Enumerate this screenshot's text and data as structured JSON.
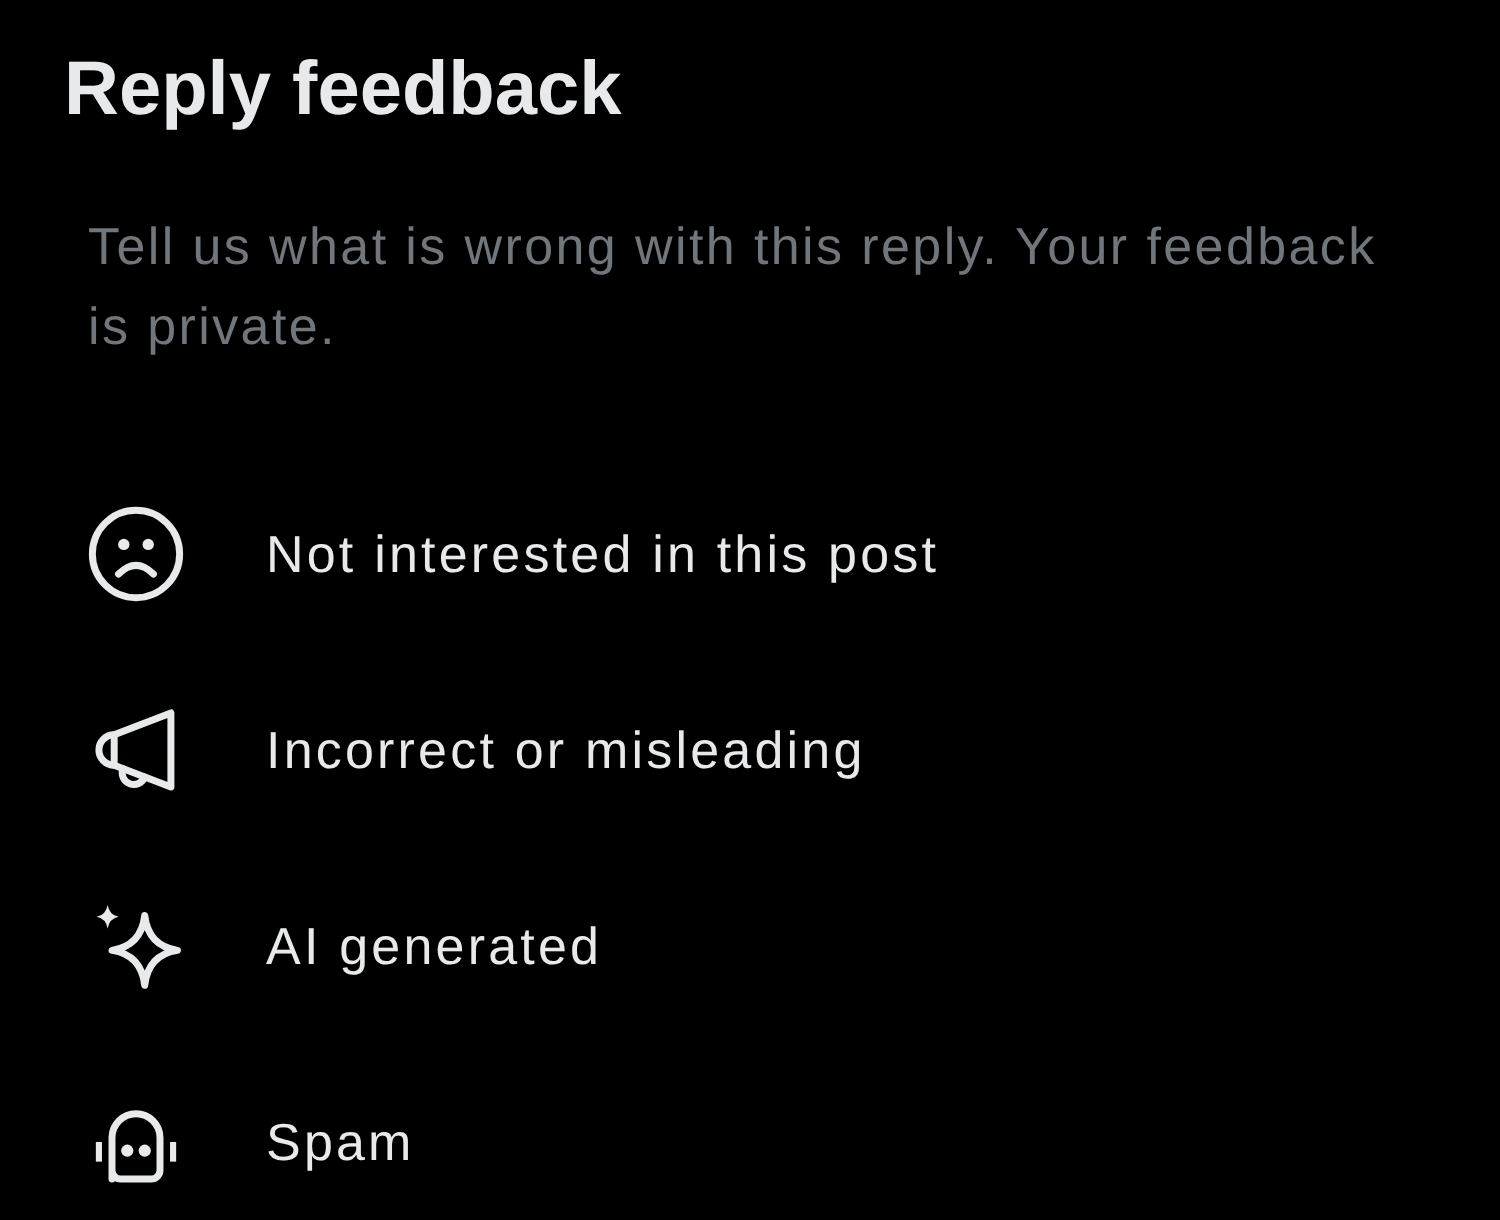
{
  "title": "Reply feedback",
  "description": "Tell us what is wrong with this reply. Your feedback is private.",
  "options": [
    {
      "kind": "sad",
      "label": "Not interested in this post"
    },
    {
      "kind": "megaphone",
      "label": "Incorrect or misleading"
    },
    {
      "kind": "sparkle",
      "label": "AI generated"
    },
    {
      "kind": "robot",
      "label": "Spam"
    }
  ]
}
